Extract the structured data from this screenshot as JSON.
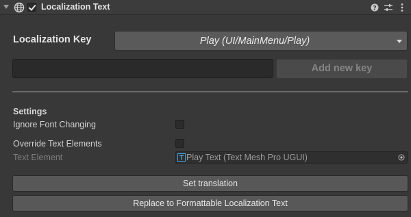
{
  "header": {
    "component_title": "Localization Text",
    "enabled": true,
    "icons": [
      "fold-arrow-icon",
      "globe-icon",
      "help-icon",
      "presets-icon",
      "more-menu-icon"
    ]
  },
  "localization_key": {
    "label": "Localization Key",
    "selected_value": "Play (UI/MainMenu/Play)"
  },
  "new_key": {
    "input_value": "",
    "add_button_label": "Add new key"
  },
  "settings": {
    "heading": "Settings",
    "ignore_font_changing": {
      "label": "Ignore Font Changing",
      "checked": false
    },
    "override_text_elements": {
      "label": "Override Text Elements",
      "checked": false
    },
    "text_element": {
      "label": "Text Element",
      "value": "Play Text (Text Mesh Pro UGUI)"
    }
  },
  "buttons": {
    "set_translation": "Set translation",
    "replace": "Replace to Formattable Localization Text"
  },
  "colors": {
    "background": "#383838",
    "dropdown": "#5a5a5a",
    "button": "#585858",
    "tmp_icon": "#4aa3df"
  }
}
